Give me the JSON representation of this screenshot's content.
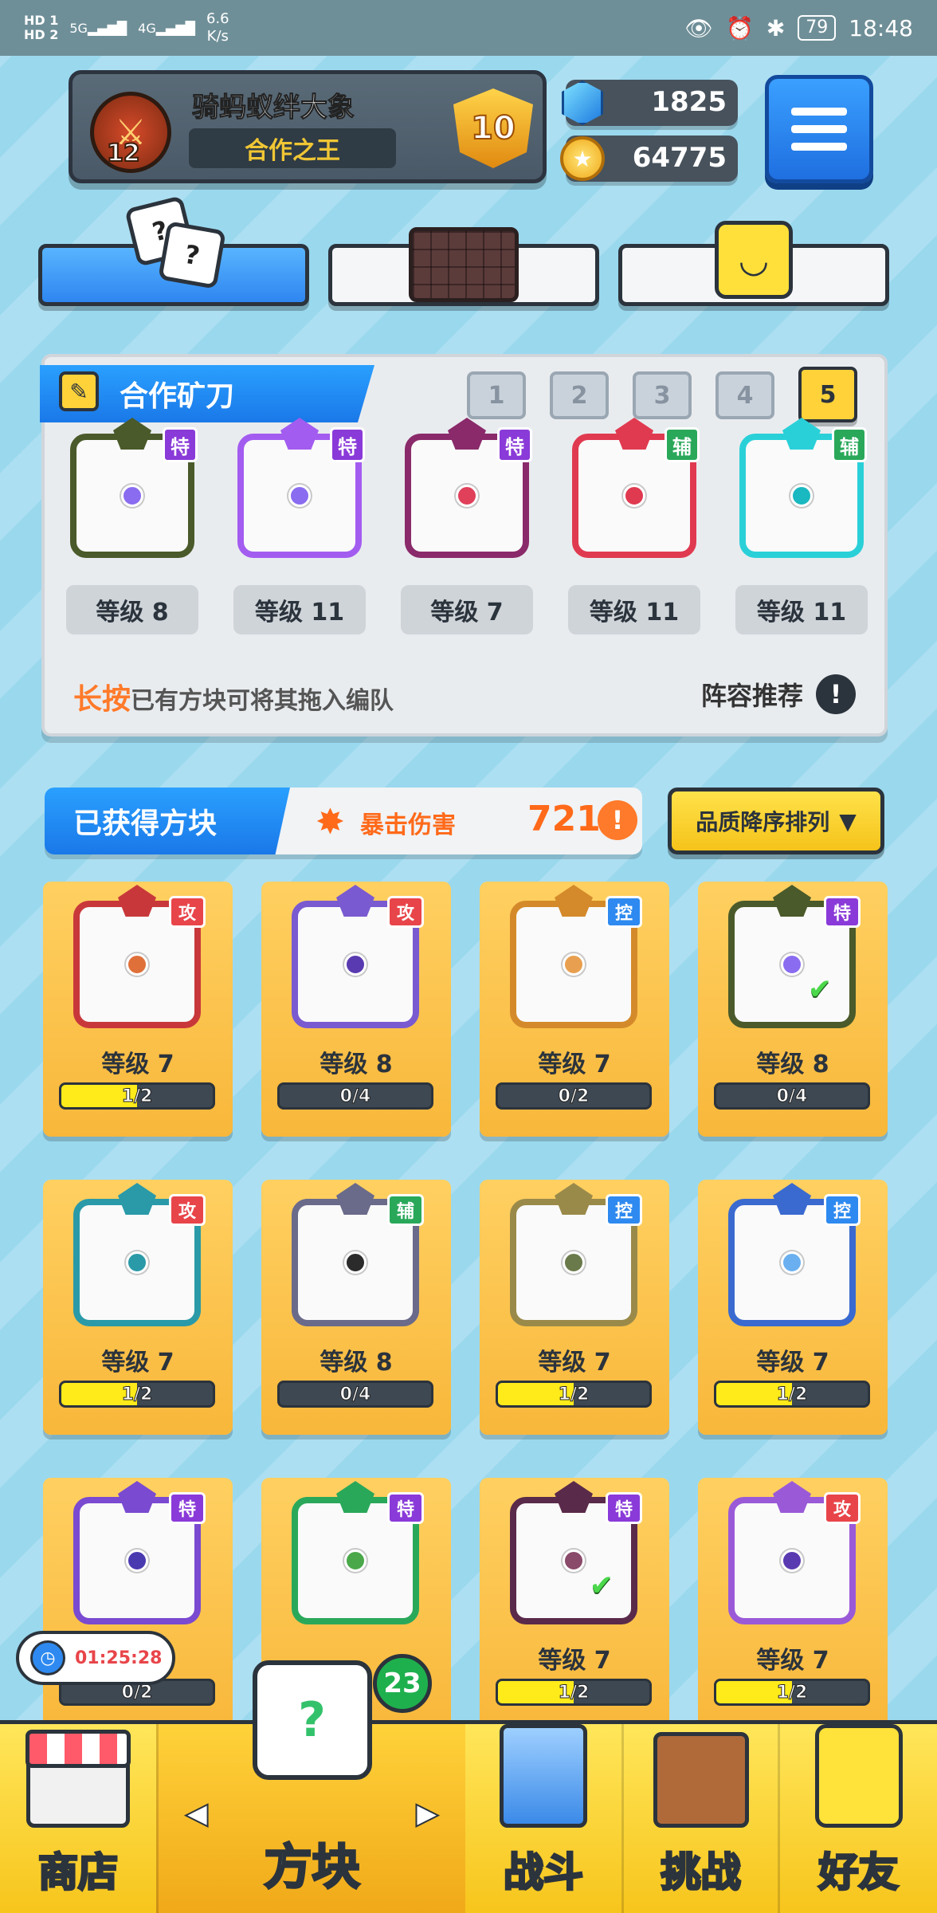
{
  "status_bar": {
    "left_top": "HD 1",
    "left_bottom": "HD 2",
    "signal1": "5G",
    "signal2": "4G",
    "speed_value": "6.6",
    "speed_unit": "K/s",
    "battery": "79",
    "time": "18:48"
  },
  "profile": {
    "name": "骑蚂蚁绊大象",
    "title": "合作之王",
    "avatar_level": "12",
    "rank": "10"
  },
  "currencies": {
    "gems": "1825",
    "coins": "64775"
  },
  "team": {
    "title": "合作矿刀",
    "decks": [
      "1",
      "2",
      "3",
      "4",
      "5"
    ],
    "active_deck": "5",
    "slots": [
      {
        "badge": "特",
        "level": "等级 8",
        "frame": "#4a5a2a",
        "dot": "#8a6cf0",
        "badge_color": "#8a3ad8"
      },
      {
        "badge": "特",
        "level": "等级 11",
        "frame": "#a35cf0",
        "dot": "#8a6cf0",
        "badge_color": "#8a3ad8"
      },
      {
        "badge": "特",
        "level": "等级 7",
        "frame": "#8a2a6a",
        "dot": "#e0405a",
        "badge_color": "#8a3ad8"
      },
      {
        "badge": "辅",
        "level": "等级 11",
        "frame": "#e03a50",
        "dot": "#e03a50",
        "badge_color": "#2aa85a"
      },
      {
        "badge": "辅",
        "level": "等级 11",
        "frame": "#2ad0d8",
        "dot": "#1ab8c0",
        "badge_color": "#2aa85a"
      }
    ],
    "hint_highlight": "长按",
    "hint_rest": "已有方块可将其拖入编队",
    "recommend_label": "阵容推荐"
  },
  "owned": {
    "title": "已获得方块",
    "crit_label": "暴击伤害",
    "crit_value": "721%",
    "sort_label": "品质降序排列",
    "cards": [
      {
        "badge": "攻",
        "badge_color": "#e8454a",
        "frame": "#c8383a",
        "dot": "#e0703a",
        "level": "等级 7",
        "progress": "1/2",
        "fill": 0.5,
        "checked": false
      },
      {
        "badge": "攻",
        "badge_color": "#e8454a",
        "frame": "#7a5ad0",
        "dot": "#5a3ab0",
        "level": "等级 8",
        "progress": "0/4",
        "fill": 0,
        "checked": false
      },
      {
        "badge": "控",
        "badge_color": "#2e8af0",
        "frame": "#d48a2a",
        "dot": "#e8a050",
        "level": "等级 7",
        "progress": "0/2",
        "fill": 0,
        "checked": false
      },
      {
        "badge": "特",
        "badge_color": "#8a3ad8",
        "frame": "#4a5a2a",
        "dot": "#8a6cf0",
        "level": "等级 8",
        "progress": "0/4",
        "fill": 0,
        "checked": true
      },
      {
        "badge": "攻",
        "badge_color": "#e8454a",
        "frame": "#2a9aa8",
        "dot": "#2a9aa8",
        "level": "等级 7",
        "progress": "1/2",
        "fill": 0.5,
        "checked": false
      },
      {
        "badge": "辅",
        "badge_color": "#2aa85a",
        "frame": "#6a6a8a",
        "dot": "#2b2b2b",
        "level": "等级 8",
        "progress": "0/4",
        "fill": 0,
        "checked": false
      },
      {
        "badge": "控",
        "badge_color": "#2e8af0",
        "frame": "#9a8a4a",
        "dot": "#6a7a4a",
        "level": "等级 7",
        "progress": "1/2",
        "fill": 0.5,
        "checked": false
      },
      {
        "badge": "控",
        "badge_color": "#2e8af0",
        "frame": "#3a6ad0",
        "dot": "#6ab0f0",
        "level": "等级 7",
        "progress": "1/2",
        "fill": 0.5,
        "checked": false
      },
      {
        "badge": "特",
        "badge_color": "#8a3ad8",
        "frame": "#7a4ad0",
        "dot": "#4a3ab0",
        "level": "",
        "progress": "0/2",
        "fill": 0,
        "checked": false
      },
      {
        "badge": "特",
        "badge_color": "#8a3ad8",
        "frame": "#2aa85a",
        "dot": "#4aa84a",
        "level": "",
        "progress": "",
        "fill": 0,
        "checked": false
      },
      {
        "badge": "特",
        "badge_color": "#8a3ad8",
        "frame": "#5a2a4a",
        "dot": "#8a4a6a",
        "level": "等级 7",
        "progress": "1/2",
        "fill": 0.5,
        "checked": true
      },
      {
        "badge": "攻",
        "badge_color": "#e8454a",
        "frame": "#9a5ad8",
        "dot": "#5a3ab0",
        "level": "等级 7",
        "progress": "1/2",
        "fill": 0.5,
        "checked": false
      }
    ]
  },
  "timer": "01:25:28",
  "nav": {
    "shop": "商店",
    "blocks": "方块",
    "battle": "战斗",
    "challenge": "挑战",
    "friends": "好友",
    "blocks_count": "23"
  }
}
